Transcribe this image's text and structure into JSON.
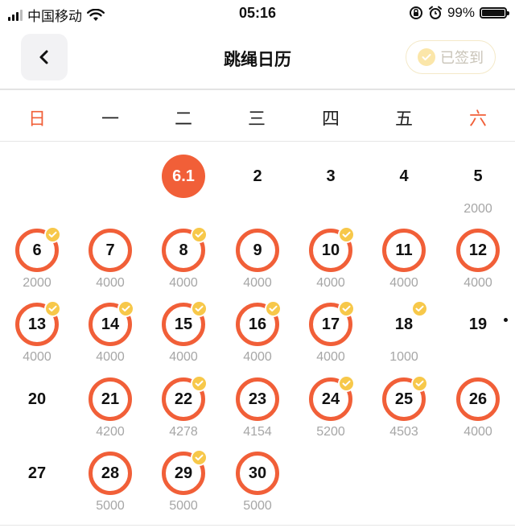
{
  "status_bar": {
    "carrier": "中国移动",
    "time": "05:16",
    "battery_pct": "99%",
    "battery_level": 0.99
  },
  "nav": {
    "title": "跳绳日历",
    "signed_in_label": "已签到"
  },
  "weekdays": [
    "日",
    "一",
    "二",
    "三",
    "四",
    "五",
    "六"
  ],
  "colors": {
    "accent": "#f15f38",
    "badge": "#f7c84a",
    "muted": "#a6a6a6"
  },
  "days": [
    {
      "label": "6.1",
      "col": 2,
      "row": 0,
      "state": "today"
    },
    {
      "label": "2",
      "col": 3,
      "row": 0,
      "state": "none"
    },
    {
      "label": "3",
      "col": 4,
      "row": 0,
      "state": "none"
    },
    {
      "label": "4",
      "col": 5,
      "row": 0,
      "state": "none"
    },
    {
      "label": "5",
      "col": 6,
      "row": 0,
      "state": "none",
      "count": "2000"
    },
    {
      "label": "6",
      "col": 0,
      "row": 1,
      "state": "ring",
      "check": true,
      "count": "2000"
    },
    {
      "label": "7",
      "col": 1,
      "row": 1,
      "state": "ring",
      "count": "4000"
    },
    {
      "label": "8",
      "col": 2,
      "row": 1,
      "state": "ring",
      "check": true,
      "count": "4000"
    },
    {
      "label": "9",
      "col": 3,
      "row": 1,
      "state": "ring",
      "count": "4000"
    },
    {
      "label": "10",
      "col": 4,
      "row": 1,
      "state": "ring",
      "check": true,
      "count": "4000"
    },
    {
      "label": "11",
      "col": 5,
      "row": 1,
      "state": "ring",
      "count": "4000"
    },
    {
      "label": "12",
      "col": 6,
      "row": 1,
      "state": "ring",
      "count": "4000"
    },
    {
      "label": "13",
      "col": 0,
      "row": 2,
      "state": "ring",
      "check": true,
      "count": "4000"
    },
    {
      "label": "14",
      "col": 1,
      "row": 2,
      "state": "ring",
      "check": true,
      "count": "4000"
    },
    {
      "label": "15",
      "col": 2,
      "row": 2,
      "state": "ring",
      "check": true,
      "count": "4000"
    },
    {
      "label": "16",
      "col": 3,
      "row": 2,
      "state": "ring",
      "check": true,
      "count": "4000"
    },
    {
      "label": "17",
      "col": 4,
      "row": 2,
      "state": "ring",
      "check": true,
      "count": "4000"
    },
    {
      "label": "18",
      "col": 5,
      "row": 2,
      "state": "none",
      "check": true,
      "count": "1000"
    },
    {
      "label": "19",
      "col": 6,
      "row": 2,
      "state": "none"
    },
    {
      "label": "20",
      "col": 0,
      "row": 3,
      "state": "none"
    },
    {
      "label": "21",
      "col": 1,
      "row": 3,
      "state": "ring",
      "count": "4200"
    },
    {
      "label": "22",
      "col": 2,
      "row": 3,
      "state": "ring",
      "check": true,
      "count": "4278"
    },
    {
      "label": "23",
      "col": 3,
      "row": 3,
      "state": "ring",
      "count": "4154"
    },
    {
      "label": "24",
      "col": 4,
      "row": 3,
      "state": "ring",
      "check": true,
      "count": "5200"
    },
    {
      "label": "25",
      "col": 5,
      "row": 3,
      "state": "ring",
      "check": true,
      "count": "4503"
    },
    {
      "label": "26",
      "col": 6,
      "row": 3,
      "state": "ring",
      "count": "4000"
    },
    {
      "label": "27",
      "col": 0,
      "row": 4,
      "state": "none"
    },
    {
      "label": "28",
      "col": 1,
      "row": 4,
      "state": "ring",
      "count": "5000"
    },
    {
      "label": "29",
      "col": 2,
      "row": 4,
      "state": "ring",
      "check": true,
      "count": "5000"
    },
    {
      "label": "30",
      "col": 3,
      "row": 4,
      "state": "ring",
      "count": "5000"
    }
  ]
}
